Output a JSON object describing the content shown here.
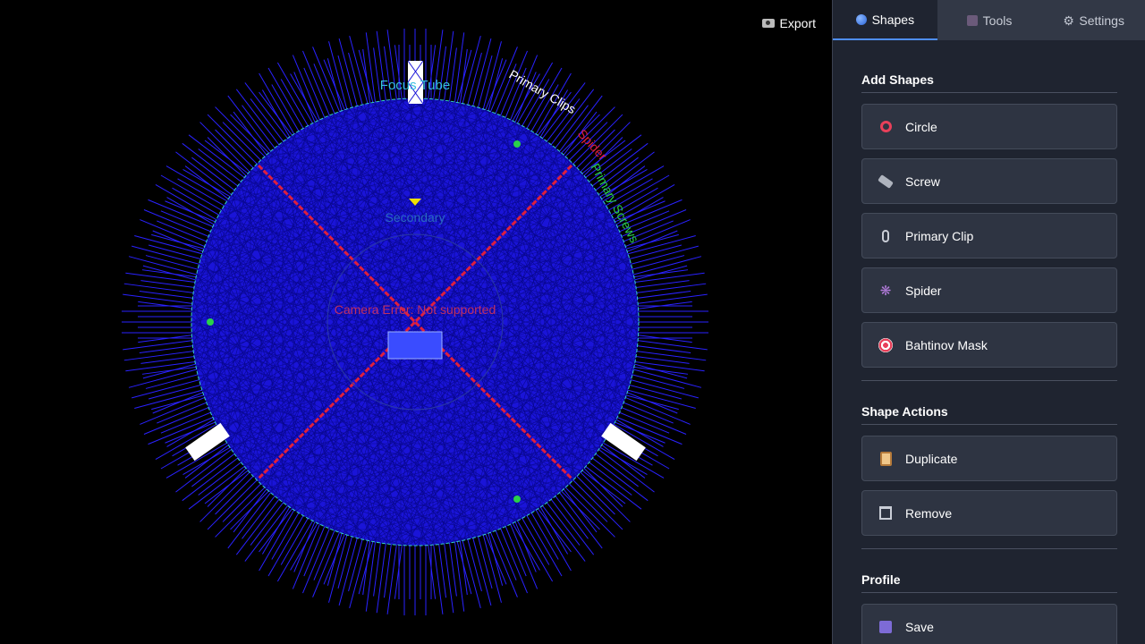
{
  "toolbar": {
    "export_label": "Export",
    "export_icon": "camera-icon"
  },
  "canvas_labels": {
    "focus_tube": "Focus Tube",
    "primary_clips": "Primary Clips",
    "spider": "Spider",
    "primary_screws": "Primary Screws",
    "secondary": "Secondary",
    "camera_error": "Camera Error: Not supported"
  },
  "colors": {
    "mask_fill": "#1a14d8",
    "spider_color": "#e0203c",
    "screw_color": "#2ad14a",
    "clip_color": "#ffffff",
    "outline_color": "#36d0c8",
    "panel_bg": "#1f2430",
    "accent": "#4f8ef7"
  },
  "tabs": [
    {
      "label": "Shapes",
      "icon": "globe-icon",
      "active": true
    },
    {
      "label": "Tools",
      "icon": "film-icon",
      "active": false
    },
    {
      "label": "Settings",
      "icon": "gear-icon",
      "active": false
    }
  ],
  "add_shapes": {
    "title": "Add Shapes",
    "buttons": [
      {
        "label": "Circle",
        "icon": "circle-icon"
      },
      {
        "label": "Screw",
        "icon": "screw-icon"
      },
      {
        "label": "Primary Clip",
        "icon": "paperclip-icon"
      },
      {
        "label": "Spider",
        "icon": "spider-icon"
      },
      {
        "label": "Bahtinov Mask",
        "icon": "target-icon"
      }
    ]
  },
  "shape_actions": {
    "title": "Shape Actions",
    "buttons": [
      {
        "label": "Duplicate",
        "icon": "clipboard-icon"
      },
      {
        "label": "Remove",
        "icon": "trash-icon"
      }
    ]
  },
  "profile": {
    "title": "Profile",
    "buttons": [
      {
        "label": "Save",
        "icon": "floppy-icon"
      }
    ]
  }
}
